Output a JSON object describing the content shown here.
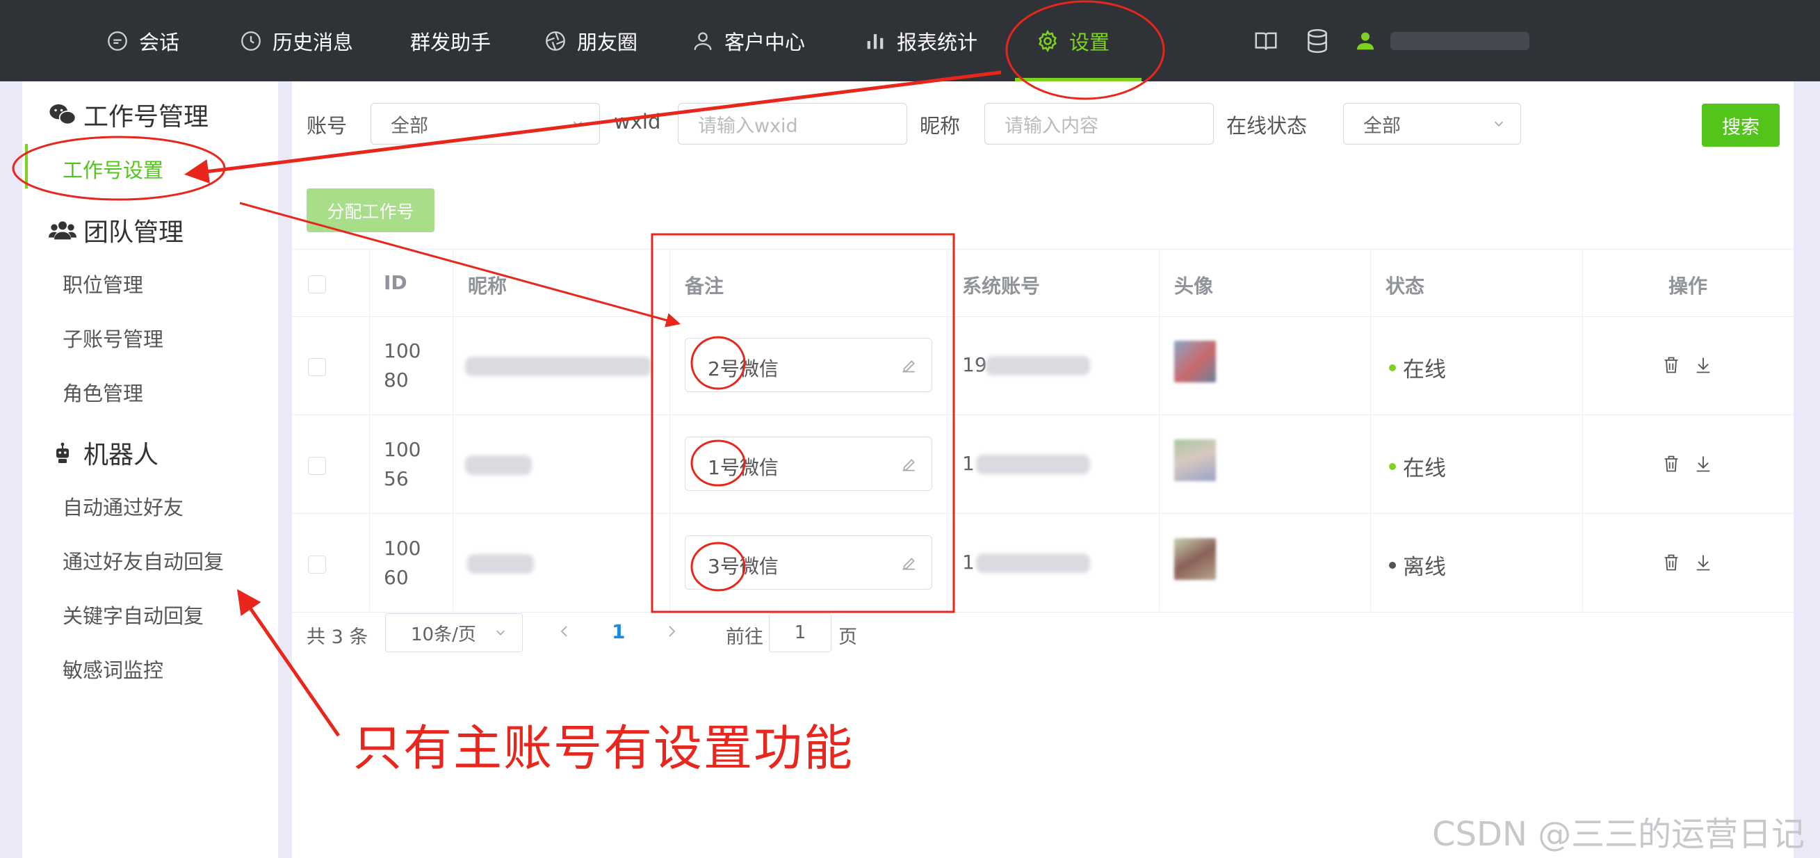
{
  "nav": {
    "items": [
      {
        "label": "会话",
        "icon": "chat-icon"
      },
      {
        "label": "历史消息",
        "icon": "clock-icon"
      },
      {
        "label": "群发助手",
        "icon": ""
      },
      {
        "label": "朋友圈",
        "icon": "aperture-icon"
      },
      {
        "label": "客户中心",
        "icon": "user-icon"
      },
      {
        "label": "报表统计",
        "icon": "bar-chart-icon"
      },
      {
        "label": "设置",
        "icon": "gear-icon"
      }
    ],
    "active_color": "#7ed321"
  },
  "sidebar": {
    "groups": [
      {
        "title": "工作号管理",
        "icon": "wechat-icon",
        "items": [
          "工作号设置"
        ]
      },
      {
        "title": "团队管理",
        "icon": "team-icon",
        "items": [
          "职位管理",
          "子账号管理",
          "角色管理"
        ]
      },
      {
        "title": "机器人",
        "icon": "robot-icon",
        "items": [
          "自动通过好友",
          "通过好友自动回复",
          "关键字自动回复",
          "敏感词监控"
        ]
      }
    ]
  },
  "filters": {
    "account_label": "账号",
    "account_value": "全部",
    "wxid_label": "wxid",
    "wxid_placeholder": "请输入wxid",
    "nickname_label": "昵称",
    "nickname_placeholder": "请输入内容",
    "online_label": "在线状态",
    "online_value": "全部",
    "search_button": "搜索"
  },
  "assign_button": "分配工作号",
  "table": {
    "headers": [
      "ID",
      "昵称",
      "备注",
      "系统账号",
      "头像",
      "状态",
      "操作"
    ],
    "rows": [
      {
        "id": "10080",
        "remark": "2号微信",
        "account_prefix": "19",
        "status": "在线"
      },
      {
        "id": "10056",
        "remark": "1号微信",
        "account_prefix": "1",
        "status": "在线"
      },
      {
        "id": "10060",
        "remark": "3号微信",
        "account_prefix": "1",
        "status": "离线"
      }
    ],
    "online_color": "#7ed321",
    "offline_color": "#555555"
  },
  "pagination": {
    "total": "共 3 条",
    "page_size": "10条/页",
    "current_page": "1",
    "goto_label": "前往",
    "goto_value": "1",
    "page_suffix": "页"
  },
  "annotation": {
    "text": "只有主账号有设置功能",
    "color": "#e8261c"
  },
  "watermark": "CSDN @三三的运营日记"
}
